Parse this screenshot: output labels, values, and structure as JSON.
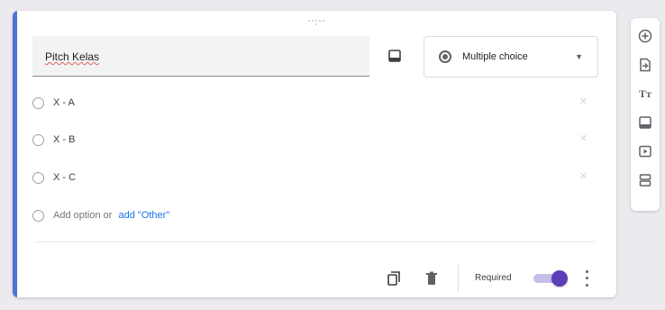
{
  "question": {
    "title": "Pitch Kelas",
    "type_label": "Multiple choice"
  },
  "options": [
    {
      "label": "X - A"
    },
    {
      "label": "X - B"
    },
    {
      "label": "X - C"
    }
  ],
  "add_option": {
    "text": "Add option or",
    "link": "add \"Other\""
  },
  "footer": {
    "required_label": "Required",
    "required_on": true
  },
  "colors": {
    "accent": "#4b74d4",
    "toggle_thumb": "#5b3fb8",
    "link": "#1a73e8"
  },
  "icons": {
    "question_image": "image-icon",
    "type_selector": "radio-button-icon",
    "duplicate": "copy-icon",
    "delete": "trash-icon",
    "more": "more-vert-icon",
    "toolbar": [
      "add-circle-icon",
      "import-icon",
      "title-icon",
      "image-icon",
      "video-icon",
      "section-icon"
    ]
  }
}
